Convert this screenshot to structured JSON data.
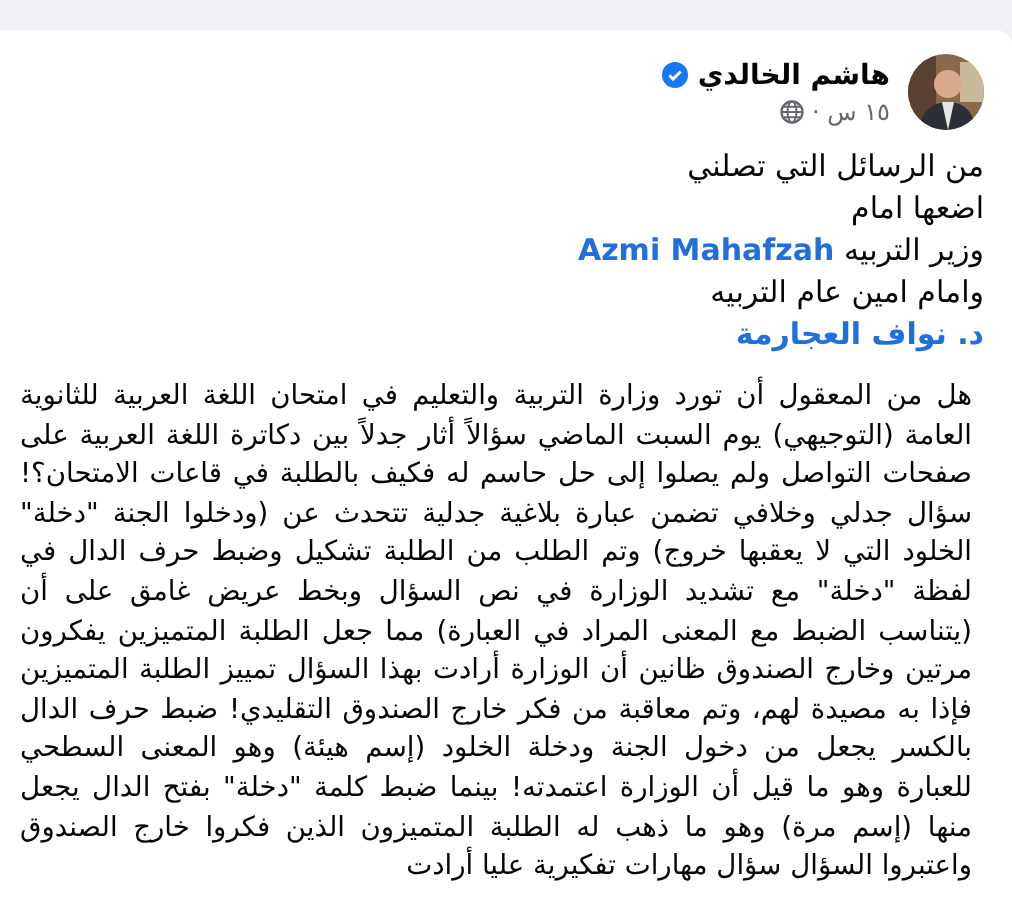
{
  "post": {
    "author": "هاشم الخالدي",
    "verified": true,
    "time": "١٥ س ·",
    "intro_lines": [
      {
        "text": "من الرسائل التي تصلني"
      },
      {
        "text": "اضعها امام"
      },
      {
        "text": "وزير التربيه",
        "link": "Azmi Mahafzah"
      },
      {
        "text": "وامام امين عام التربيه"
      },
      {
        "link": "د. نواف العجارمة"
      }
    ],
    "body": "هل من المعقول أن تورد وزارة التربية والتعليم في امتحان اللغة العربية للثانوية العامة (التوجيهي) يوم السبت الماضي سؤالاً أثار جدلاً بين دكاترة اللغة العربية على صفحات التواصل ولم يصلوا إلى حل حاسم له فكيف بالطلبة في قاعات الامتحان؟! سؤال جدلي وخلافي تضمن عبارة بلاغية جدلية تتحدث عن (ودخلوا الجنة \"دخلة\" الخلود التي لا يعقبها خروج) وتم الطلب من الطلبة تشكيل وضبط حرف الدال في لفظة \"دخلة\" مع تشديد الوزارة في نص السؤال وبخط عريض غامق على أن (يتناسب الضبط مع المعنى المراد في العبارة) مما جعل الطلبة المتميزين يفكرون مرتين وخارج الصندوق ظانين أن الوزارة أرادت بهذا السؤال تمييز الطلبة المتميزين فإذا به مصيدة لهم، وتم معاقبة من فكر خارج الصندوق التقليدي! ضبط حرف الدال بالكسر يجعل من دخول الجنة ودخلة الخلود (إسم هيئة) وهو المعنى السطحي للعبارة وهو ما قيل أن الوزارة اعتمدته! بينما ضبط كلمة \"دخلة\" بفتح الدال يجعل منها (إسم مرة) وهو ما ذهب له الطلبة المتميزون الذين فكروا خارج الصندوق واعتبروا السؤال سؤال مهارات تفكيرية عليا أرادت"
  }
}
